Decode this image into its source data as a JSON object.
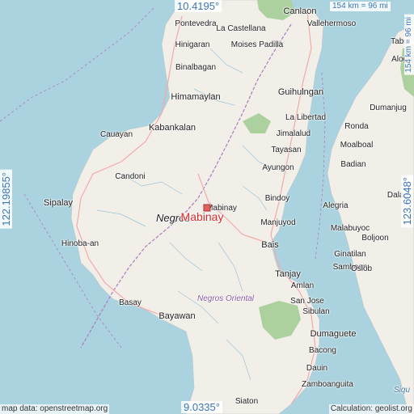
{
  "map": {
    "places": [
      {
        "name": "Canlaon",
        "kind": "big"
      },
      {
        "name": "Pontevedra",
        "kind": "town"
      },
      {
        "name": "La Castellana",
        "kind": "town"
      },
      {
        "name": "Vallehermoso",
        "kind": "town"
      },
      {
        "name": "Hinigaran",
        "kind": "town"
      },
      {
        "name": "Moises Padilla",
        "kind": "town"
      },
      {
        "name": "Binalbagan",
        "kind": "town"
      },
      {
        "name": "Himamaylan",
        "kind": "big"
      },
      {
        "name": "Guihulngan",
        "kind": "big"
      },
      {
        "name": "Kabankalan",
        "kind": "big"
      },
      {
        "name": "La Libertad",
        "kind": "town"
      },
      {
        "name": "Cauayan",
        "kind": "town"
      },
      {
        "name": "Jimalalud",
        "kind": "town"
      },
      {
        "name": "Tayasan",
        "kind": "town"
      },
      {
        "name": "Ayungon",
        "kind": "town"
      },
      {
        "name": "Candoni",
        "kind": "town"
      },
      {
        "name": "Sipalay",
        "kind": "big"
      },
      {
        "name": "Bindoy",
        "kind": "town"
      },
      {
        "name": "Mabinay",
        "kind": "town"
      },
      {
        "name": "Manjuyod",
        "kind": "town"
      },
      {
        "name": "Bais",
        "kind": "big"
      },
      {
        "name": "Hinoba-an",
        "kind": "town"
      },
      {
        "name": "Tanjay",
        "kind": "big"
      },
      {
        "name": "Amlan",
        "kind": "town"
      },
      {
        "name": "San Jose",
        "kind": "town"
      },
      {
        "name": "Basay",
        "kind": "town"
      },
      {
        "name": "Bayawan",
        "kind": "big"
      },
      {
        "name": "Sibulan",
        "kind": "town"
      },
      {
        "name": "Dumaguete",
        "kind": "big"
      },
      {
        "name": "Bacong",
        "kind": "town"
      },
      {
        "name": "Dauin",
        "kind": "town"
      },
      {
        "name": "Zamboanguita",
        "kind": "town"
      },
      {
        "name": "Siaton",
        "kind": "town"
      },
      {
        "name": "Tabu",
        "kind": "town"
      },
      {
        "name": "Alogui",
        "kind": "town"
      },
      {
        "name": "Dumanjug",
        "kind": "town"
      },
      {
        "name": "Ronda",
        "kind": "town"
      },
      {
        "name": "Moalboal",
        "kind": "town"
      },
      {
        "name": "Badian",
        "kind": "town"
      },
      {
        "name": "Dalag",
        "kind": "town"
      },
      {
        "name": "Alegria",
        "kind": "town"
      },
      {
        "name": "Malabuyoc",
        "kind": "town"
      },
      {
        "name": "Boljoon",
        "kind": "town"
      },
      {
        "name": "Ginatilan",
        "kind": "town"
      },
      {
        "name": "Samboan",
        "kind": "town"
      },
      {
        "name": "Oslob",
        "kind": "town"
      }
    ],
    "province_label": "Negros",
    "region_label": "Negros Oriental",
    "sea_label": "Siqu",
    "target": {
      "name": "Mabinay",
      "color": "#d62d2d"
    },
    "coords": {
      "top": "10.4195°",
      "bottom": "9.0335°",
      "left": "122.19855°",
      "right": "123.6048°"
    },
    "scale_h": "154 km = 96 mi",
    "scale_v": "154 km = 96 mi",
    "footer_left": "map data: openstreetmap.org",
    "footer_right": "Calculation: geolist.org",
    "colors": {
      "water": "#aad3df",
      "land": "#f2efe9",
      "forest": "#add19e",
      "boundary": "#a97bbf",
      "road": "#f4a9a9",
      "river": "#9cc4d6"
    }
  }
}
